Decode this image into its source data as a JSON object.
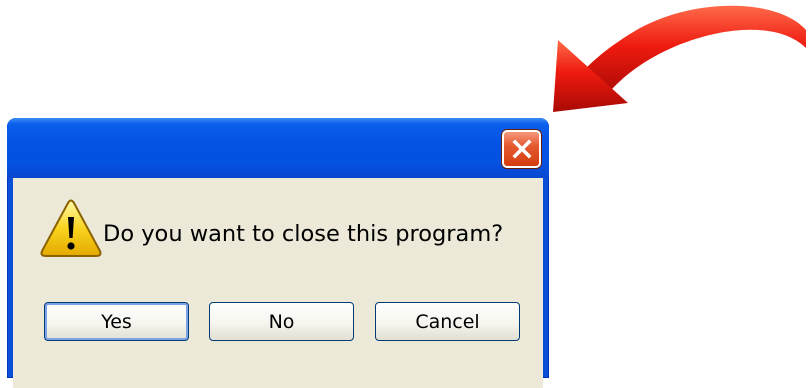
{
  "colors": {
    "title_bar": "#0553e4",
    "client_bg": "#ece9d8",
    "close_button": "#e65a31",
    "button_border": "#003c74",
    "warning_icon": "#f5c400",
    "arrow": "#e8150d"
  },
  "dialog": {
    "title": "",
    "message": "Do you want to close this program?",
    "icon": "warning-icon",
    "close_icon": "close-icon"
  },
  "buttons": {
    "yes_label": "Yes",
    "no_label": "No",
    "cancel_label": "Cancel"
  },
  "annotation": {
    "icon": "curved-arrow-icon",
    "points_to": "close-button"
  }
}
